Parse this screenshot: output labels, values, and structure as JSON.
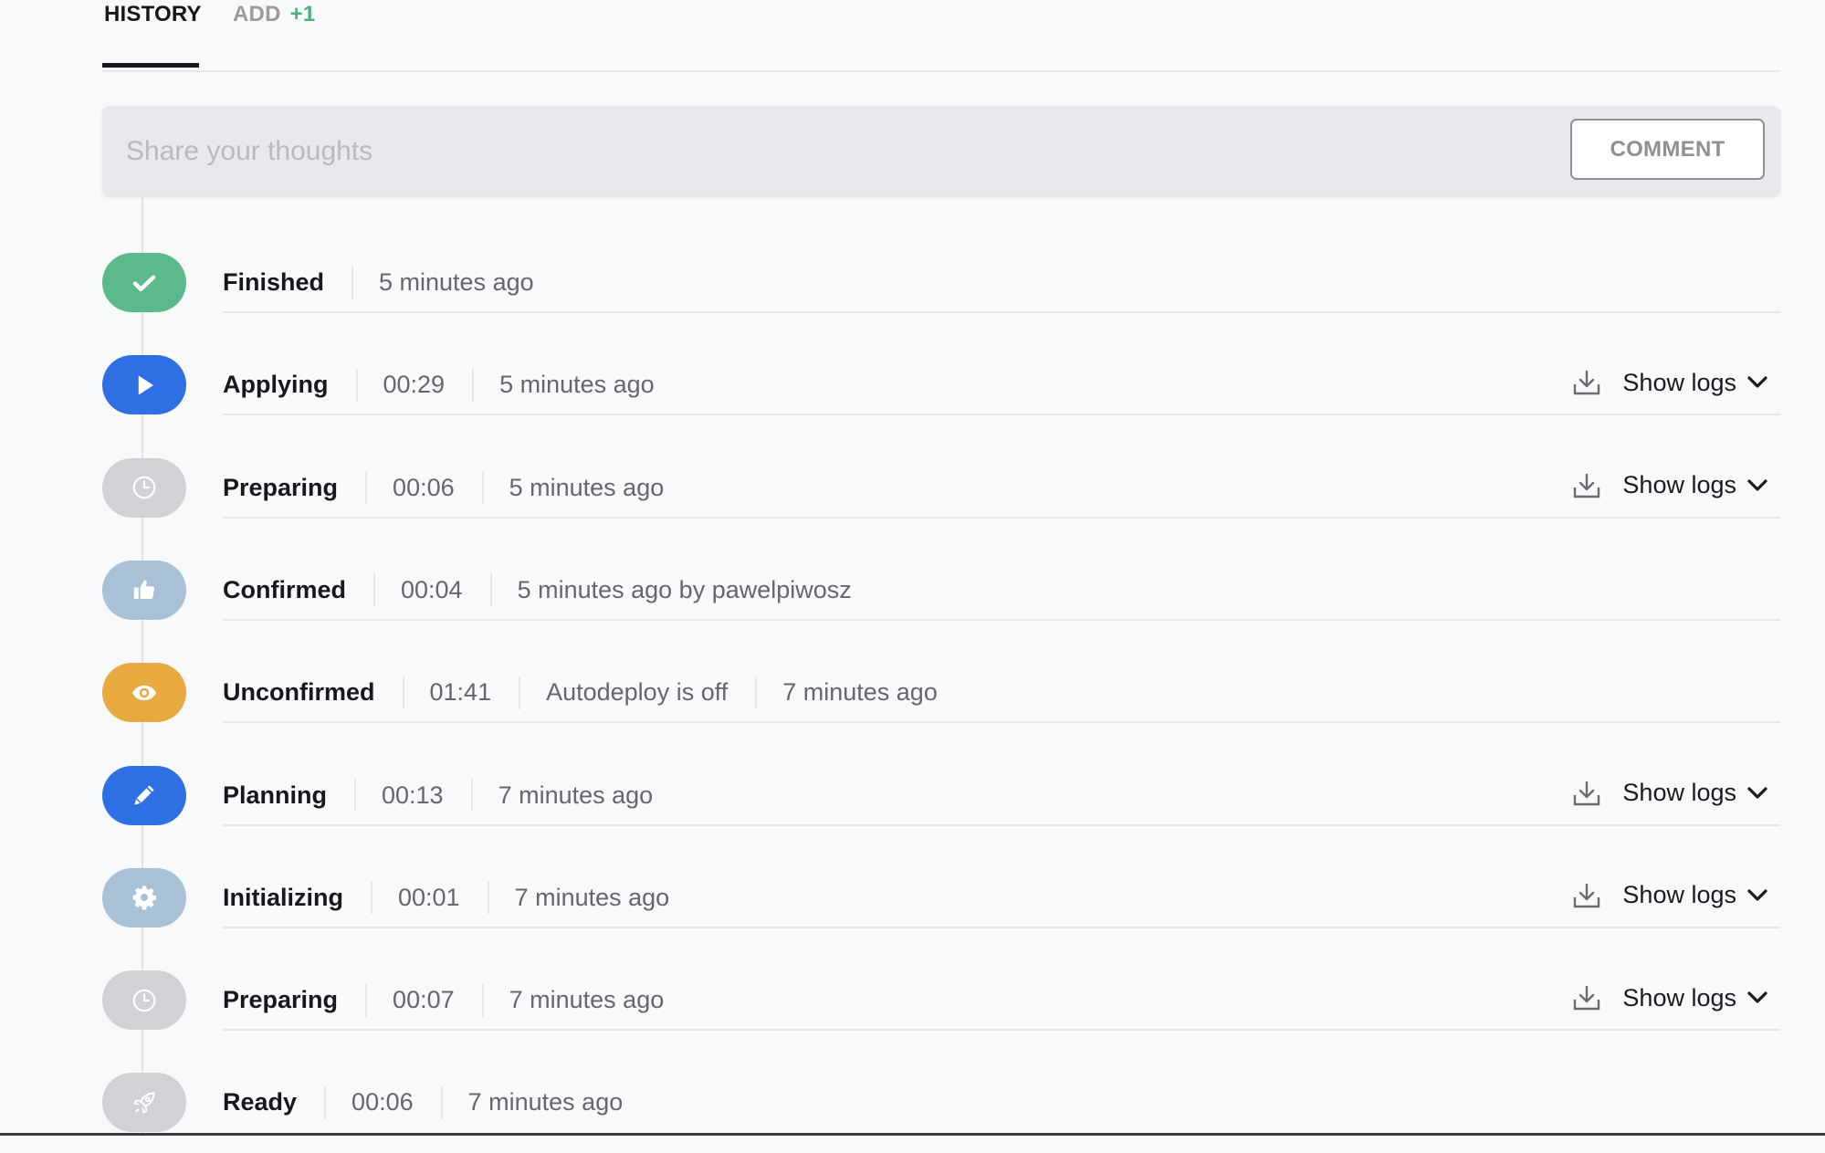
{
  "tabs": {
    "history_label": "HISTORY",
    "add_label": "ADD",
    "add_count": "+1",
    "active": "history"
  },
  "comment": {
    "placeholder": "Share your thoughts",
    "value": "",
    "button_label": "COMMENT"
  },
  "colors": {
    "finished": "#5bb98b",
    "applying": "#2f6fe4",
    "preparing": "#d1d2d6",
    "confirmed": "#a9c1d6",
    "unconfirmed": "#e8a93e",
    "planning": "#2f6fe4",
    "initializing": "#a9c1d6",
    "ready": "#d1d2d6"
  },
  "history": [
    {
      "status": "Finished",
      "icon": "check-icon",
      "color_key": "finished",
      "meta": [
        "5 minutes ago"
      ],
      "show_logs": false
    },
    {
      "status": "Applying",
      "icon": "play-icon",
      "color_key": "applying",
      "meta": [
        "00:29",
        "5 minutes ago"
      ],
      "show_logs": true
    },
    {
      "status": "Preparing",
      "icon": "clock-icon",
      "color_key": "preparing",
      "meta": [
        "00:06",
        "5 minutes ago"
      ],
      "show_logs": true
    },
    {
      "status": "Confirmed",
      "icon": "thumbs-up-icon",
      "color_key": "confirmed",
      "meta": [
        "00:04",
        "5 minutes ago by pawelpiwosz"
      ],
      "show_logs": false
    },
    {
      "status": "Unconfirmed",
      "icon": "eye-icon",
      "color_key": "unconfirmed",
      "meta": [
        "01:41",
        "Autodeploy is off",
        "7 minutes ago"
      ],
      "show_logs": false
    },
    {
      "status": "Planning",
      "icon": "pencil-icon",
      "color_key": "planning",
      "meta": [
        "00:13",
        "7 minutes ago"
      ],
      "show_logs": true
    },
    {
      "status": "Initializing",
      "icon": "gear-icon",
      "color_key": "initializing",
      "meta": [
        "00:01",
        "7 minutes ago"
      ],
      "show_logs": true
    },
    {
      "status": "Preparing",
      "icon": "clock-icon",
      "color_key": "preparing",
      "meta": [
        "00:07",
        "7 minutes ago"
      ],
      "show_logs": true
    },
    {
      "status": "Ready",
      "icon": "rocket-icon",
      "color_key": "ready",
      "meta": [
        "00:06",
        "7 minutes ago"
      ],
      "show_logs": false
    }
  ],
  "show_logs_label": "Show logs"
}
